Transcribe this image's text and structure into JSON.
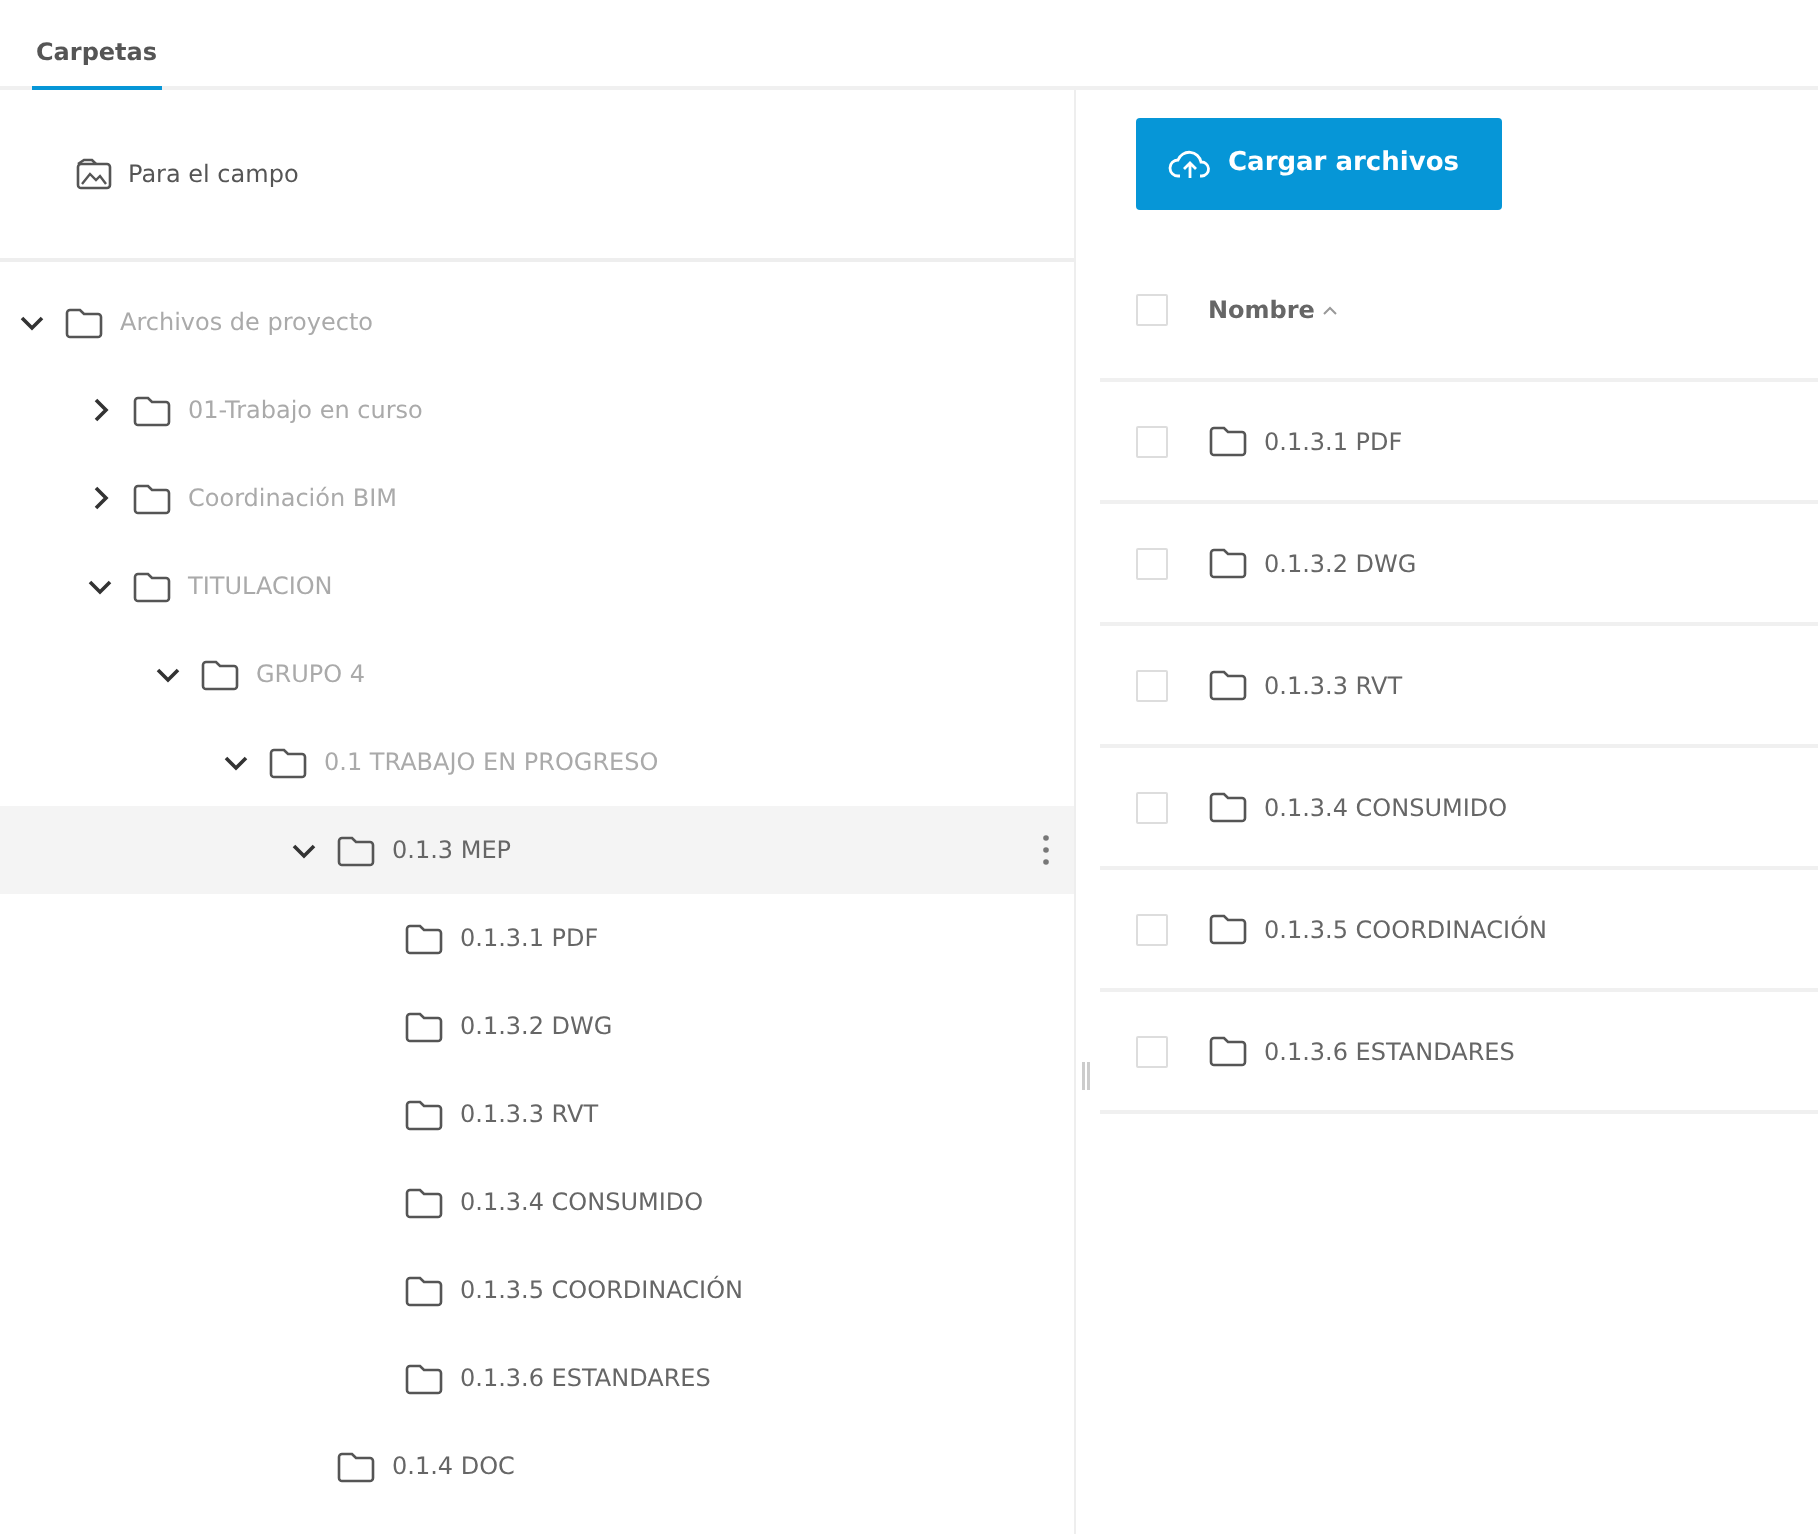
{
  "tabs": [
    {
      "label": "Carpetas",
      "selected": true
    }
  ],
  "field_link": {
    "label": "Para el campo"
  },
  "tree": [
    {
      "label": "Archivos de proyecto",
      "expanded": true,
      "selected": false,
      "muted": true,
      "children": [
        {
          "label": "01-Trabajo en curso",
          "expanded": false,
          "selected": false,
          "muted": true
        },
        {
          "label": "Coordinación BIM",
          "expanded": false,
          "selected": false,
          "muted": true
        },
        {
          "label": "TITULACION",
          "expanded": true,
          "selected": false,
          "muted": true,
          "children": [
            {
              "label": "GRUPO 4",
              "expanded": true,
              "selected": false,
              "muted": true,
              "children": [
                {
                  "label": "0.1 TRABAJO EN PROGRESO",
                  "expanded": true,
                  "selected": false,
                  "muted": true,
                  "children": [
                    {
                      "label": "0.1.3 MEP",
                      "expanded": true,
                      "selected": true,
                      "muted": false,
                      "children": [
                        {
                          "label": "0.1.3.1 PDF",
                          "selected": false,
                          "muted": false
                        },
                        {
                          "label": "0.1.3.2 DWG",
                          "selected": false,
                          "muted": false
                        },
                        {
                          "label": "0.1.3.3 RVT",
                          "selected": false,
                          "muted": false
                        },
                        {
                          "label": "0.1.3.4 CONSUMIDO",
                          "selected": false,
                          "muted": false
                        },
                        {
                          "label": "0.1.3.5 COORDINACIÓN",
                          "selected": false,
                          "muted": false
                        },
                        {
                          "label": "0.1.3.6 ESTANDARES",
                          "selected": false,
                          "muted": false
                        }
                      ]
                    },
                    {
                      "label": "0.1.4 DOC",
                      "selected": false,
                      "muted": false
                    }
                  ]
                }
              ]
            }
          ]
        }
      ]
    }
  ],
  "upload_button": {
    "label": "Cargar archivos"
  },
  "table": {
    "header": {
      "label": "Nombre",
      "checked": false
    },
    "rows": [
      {
        "name": "0.1.3.1 PDF",
        "checked": false
      },
      {
        "name": "0.1.3.2 DWG",
        "checked": false
      },
      {
        "name": "0.1.3.3 RVT",
        "checked": false
      },
      {
        "name": "0.1.3.4 CONSUMIDO",
        "checked": false
      },
      {
        "name": "0.1.3.5 COORDINACIÓN",
        "checked": false
      },
      {
        "name": "0.1.3.6 ESTANDARES",
        "checked": false
      }
    ]
  }
}
